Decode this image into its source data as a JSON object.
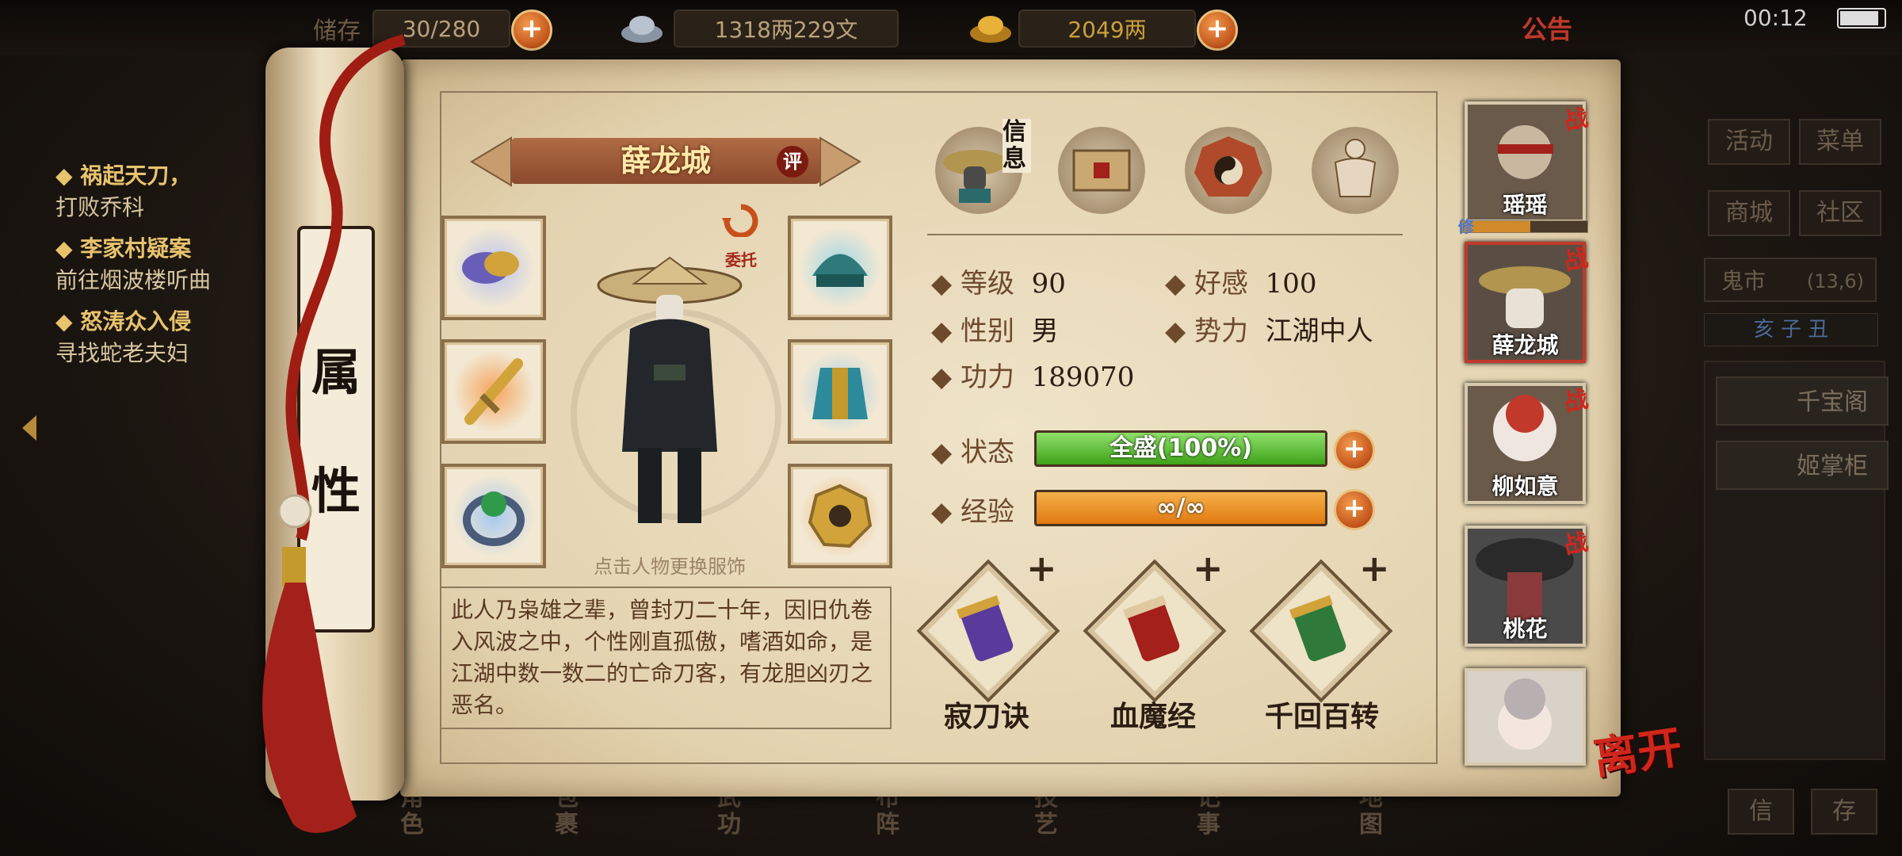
{
  "top_bar": {
    "backpack_label": "储存",
    "backpack_count": "30/280",
    "silver": "1318两229文",
    "gold": "2049两",
    "notice": "公告",
    "time": "00:12"
  },
  "quests": [
    {
      "title": "◆ 祸起天刀，",
      "desc": "打败乔科"
    },
    {
      "title": "◆ 李家村疑案",
      "desc": "前往烟波楼听曲"
    },
    {
      "title": "◆ 怒涛众入侵",
      "desc": "寻找蛇老夫妇"
    }
  ],
  "scroll_title": [
    "属",
    "性"
  ],
  "character": {
    "name": "薛龙城",
    "review_badge": "评",
    "entrust_label": "委托",
    "outfit_hint": "点击人物更换服饰",
    "description": "此人乃枭雄之辈，曾封刀二十年，因旧仇卷入风波之中，个性刚直孤傲，嗜酒如命，是江湖中数一数二的亡命刀客，有龙胆凶刃之恶名。"
  },
  "tabs": {
    "info_label": "信息"
  },
  "stats": {
    "level_label": "等级",
    "level": "90",
    "favor_label": "好感",
    "favor": "100",
    "gender_label": "性别",
    "gender": "男",
    "faction_label": "势力",
    "faction": "江湖中人",
    "power_label": "功力",
    "power": "189070",
    "status_label": "状态",
    "status_text": "全盛(100%)",
    "status_pct": 100,
    "exp_label": "经验",
    "exp_text": "∞/∞"
  },
  "skills": [
    {
      "name": "寂刀诀"
    },
    {
      "name": "血魔经"
    },
    {
      "name": "千回百转"
    }
  ],
  "party": [
    {
      "name": "瑶瑶",
      "badge": "战",
      "tag": "修"
    },
    {
      "name": "薛龙城",
      "badge": "战"
    },
    {
      "name": "柳如意",
      "badge": "战"
    },
    {
      "name": "桃花",
      "badge": "战"
    },
    {
      "name": ""
    }
  ],
  "leave_label": "离开",
  "right_menu": {
    "activity": "活动",
    "menu": "菜单",
    "mall": "商城",
    "community": "社区",
    "ghost_market": "鬼市",
    "coords": "(13,6)",
    "time_strip": "亥 子 丑",
    "shop1": "千宝阁",
    "shop2": "姬掌柜",
    "btn_letter": "信",
    "btn_save": "存"
  },
  "bottom_menu": [
    "角色",
    "包裹",
    "武功",
    "布阵",
    "技艺",
    "记事",
    "地图"
  ],
  "colors": {
    "accent_red": "#c0392b",
    "status_green": "#3fa21a",
    "exp_orange": "#e07a10"
  }
}
